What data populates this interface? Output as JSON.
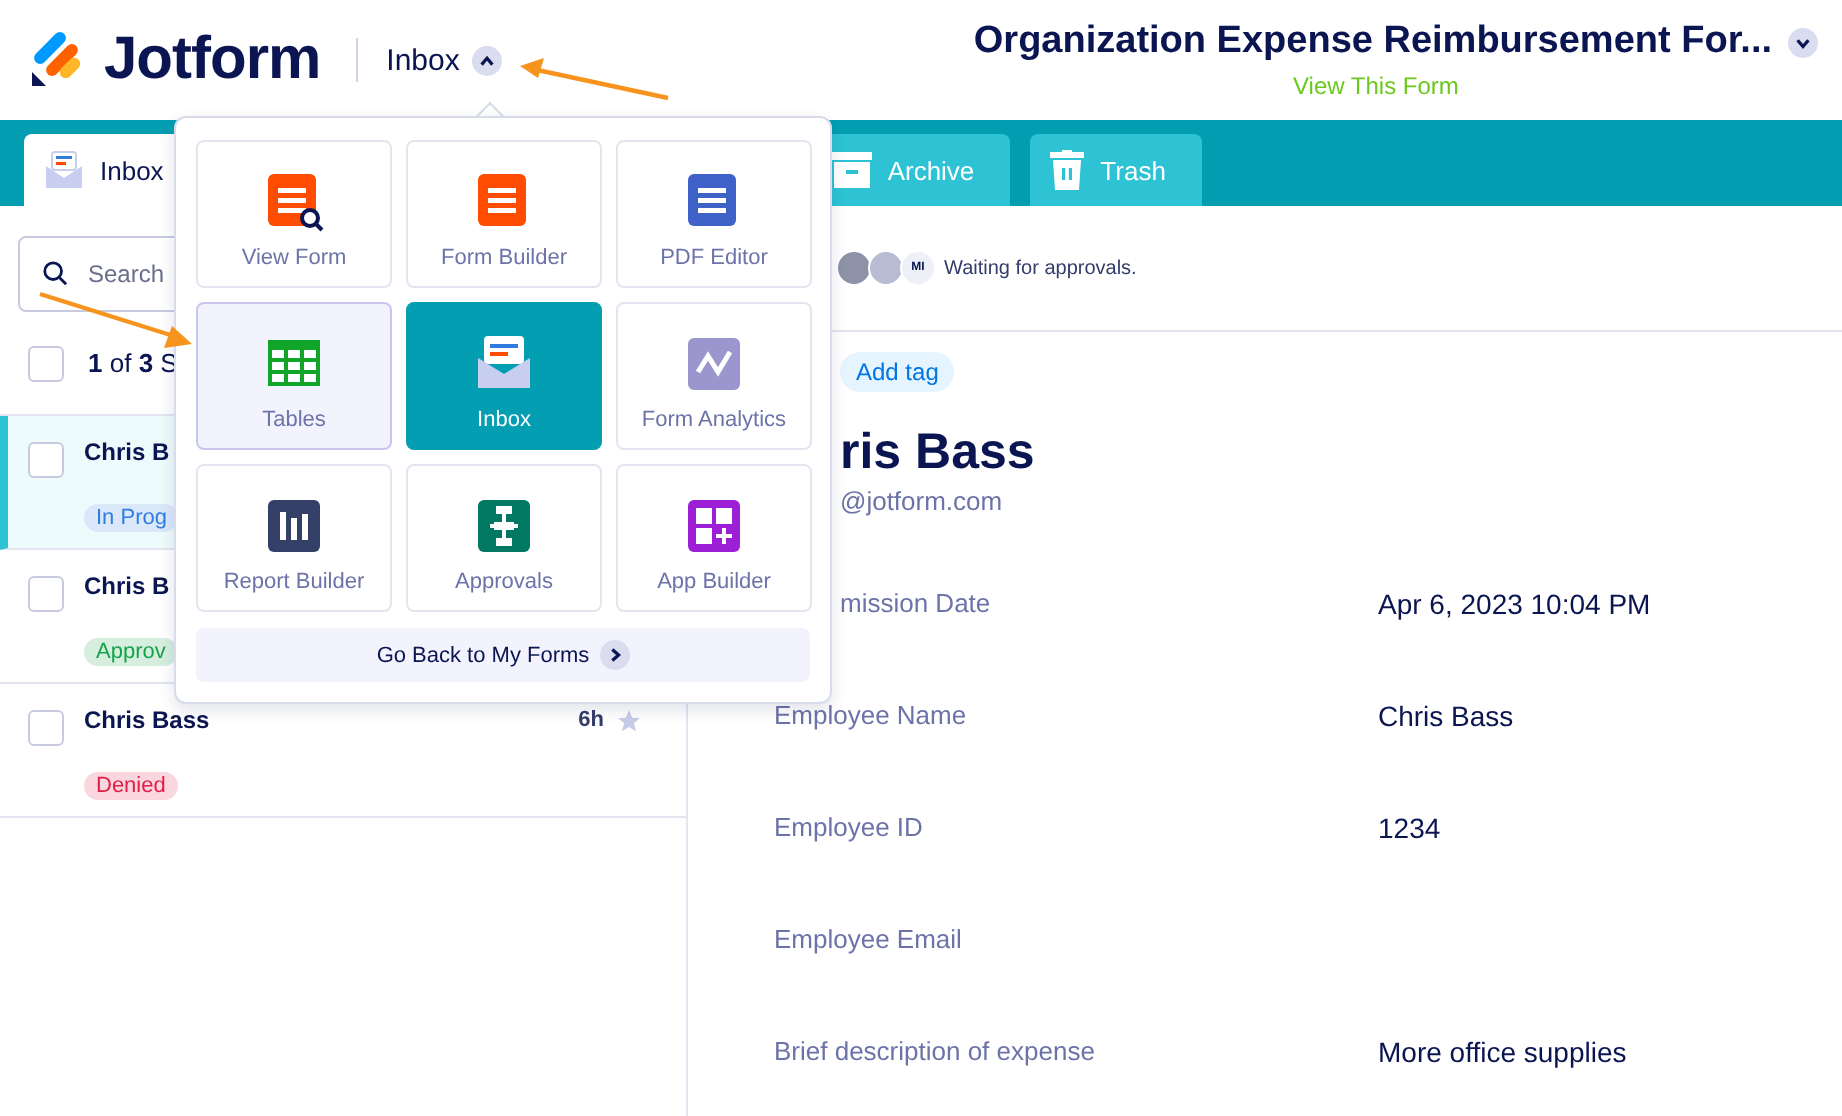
{
  "header": {
    "brand": "Jotform",
    "section": "Inbox",
    "form_title": "Organization Expense Reimbursement For...",
    "view_link": "View This Form"
  },
  "tabs": [
    {
      "label": "Inbox",
      "selected": true,
      "kind": "inbox"
    },
    {
      "label": "Archive",
      "selected": false,
      "kind": "archive"
    },
    {
      "label": "Trash",
      "selected": false,
      "kind": "trash"
    }
  ],
  "search": {
    "placeholder": "Search"
  },
  "list_header": {
    "checked": false,
    "count": "**1** of **3** S"
  },
  "submissions": [
    {
      "name": "Chris B",
      "selected": true,
      "checked": false,
      "tag": {
        "label": "In Prog",
        "color": "#2f7de1"
      }
    },
    {
      "name": "Chris B",
      "selected": false,
      "checked": false,
      "tag": {
        "label": "Approv",
        "color": "#16a34a"
      }
    },
    {
      "name": "Chris Bass",
      "selected": false,
      "checked": false,
      "time": "6h",
      "starred": false,
      "tag": {
        "label": "Denied",
        "color": "#e11d48"
      }
    }
  ],
  "detail": {
    "approvers": [
      {
        "kind": "photo"
      },
      {
        "kind": "photo"
      },
      {
        "kind": "initials",
        "initials": "MI"
      }
    ],
    "approval_status": "Waiting for approvals.",
    "add_tag": "Add tag",
    "name": "ris Bass",
    "email": "@jotform.com",
    "fields": [
      {
        "label": "mission Date",
        "value": "Apr 6, 2023 10:04 PM"
      },
      {
        "label": "Employee Name",
        "value": "Chris Bass"
      },
      {
        "label": "Employee ID",
        "value": "1234"
      },
      {
        "label": "Employee Email"
      },
      {
        "label": "Brief description of expense",
        "value": "More office supplies"
      }
    ]
  },
  "app_menu": {
    "tiles": [
      {
        "label": "View Form",
        "kind": "view-form",
        "selected": false,
        "hovered": false
      },
      {
        "label": "Form Builder",
        "kind": "form-builder",
        "selected": false,
        "hovered": false
      },
      {
        "label": "PDF Editor",
        "kind": "pdf-editor",
        "selected": false,
        "hovered": false
      },
      {
        "label": "Tables",
        "kind": "tables",
        "selected": false,
        "hovered": true
      },
      {
        "label": "Inbox",
        "kind": "inbox",
        "selected": true,
        "hovered": false
      },
      {
        "label": "Form Analytics",
        "kind": "analytics",
        "selected": false,
        "hovered": false
      },
      {
        "label": "Report Builder",
        "kind": "report",
        "selected": false,
        "hovered": false
      },
      {
        "label": "Approvals",
        "kind": "approvals",
        "selected": false,
        "hovered": false
      },
      {
        "label": "App Builder",
        "kind": "app-builder",
        "selected": false,
        "hovered": false
      }
    ],
    "back_button": "Go Back to My Forms"
  }
}
